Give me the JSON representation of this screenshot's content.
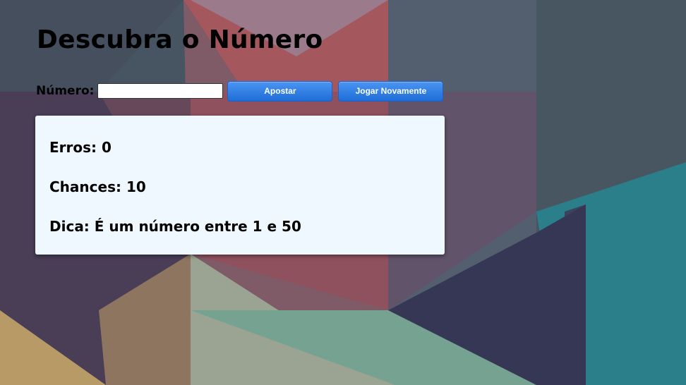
{
  "page": {
    "title": "Descubra o Número"
  },
  "form": {
    "number_label": "Número:",
    "number_value": "",
    "bet_button": "Apostar",
    "play_again_button": "Jogar Novamente"
  },
  "stats": {
    "errors_label": "Erros:",
    "errors_value": "0",
    "chances_label": "Chances:",
    "chances_value": "10",
    "hint_label": "Dica:",
    "hint_value": "É um número entre 1 e 50"
  },
  "colors": {
    "panel_background": "#f0f8ff",
    "button_blue": "#1e6ed8",
    "text": "#000000"
  }
}
